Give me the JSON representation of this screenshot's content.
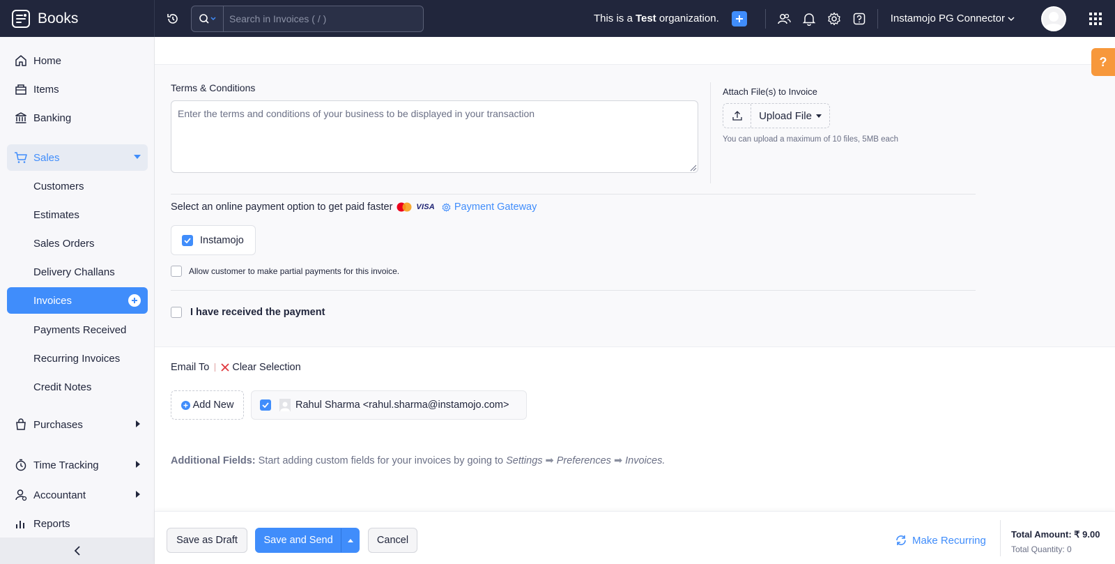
{
  "app": {
    "name": "Books"
  },
  "search": {
    "placeholder": "Search in Invoices ( / )"
  },
  "header": {
    "org_prefix": "This is a ",
    "org_bold": "Test",
    "org_suffix": " organization.",
    "org_name": "Instamojo PG Connector"
  },
  "sidebar": {
    "items": [
      {
        "label": "Home",
        "icon": "home-icon"
      },
      {
        "label": "Items",
        "icon": "items-icon"
      },
      {
        "label": "Banking",
        "icon": "bank-icon"
      },
      {
        "label": "Sales",
        "icon": "cart-icon"
      },
      {
        "label": "Purchases",
        "icon": "bag-icon"
      },
      {
        "label": "Time Tracking",
        "icon": "clock-icon"
      },
      {
        "label": "Accountant",
        "icon": "accountant-icon"
      },
      {
        "label": "Reports",
        "icon": "reports-icon"
      }
    ],
    "sales_sub": [
      "Customers",
      "Estimates",
      "Sales Orders",
      "Delivery Challans",
      "Invoices",
      "Payments Received",
      "Recurring Invoices",
      "Credit Notes"
    ]
  },
  "form": {
    "terms_label": "Terms & Conditions",
    "terms_placeholder": "Enter the terms and conditions of your business to be displayed in your transaction",
    "attach_label": "Attach File(s) to Invoice",
    "upload_label": "Upload File",
    "upload_hint": "You can upload a maximum of 10 files, 5MB each",
    "payment_text": "Select an online payment option to get paid faster",
    "visa": "VISA",
    "payment_gateway": "Payment Gateway",
    "instamojo": "Instamojo",
    "partial": "Allow customer to make partial payments for this invoice.",
    "received": "I have received the payment",
    "email_to": "Email To",
    "clear_selection": "Clear Selection",
    "add_new": "Add New",
    "contact": "Rahul Sharma <rahul.sharma@instamojo.com>",
    "additional_bold": "Additional Fields:",
    "additional_text": " Start adding custom fields for your invoices by going to ",
    "additional_settings": "Settings",
    "additional_prefs": "Preferences",
    "additional_invoices": "Invoices."
  },
  "footer": {
    "save_draft": "Save as Draft",
    "save_send": "Save and Send",
    "cancel": "Cancel",
    "make_recurring": "Make Recurring",
    "total_amount": "Total Amount: ₹ 9.00",
    "total_quantity": "Total Quantity: 0"
  },
  "help": {
    "label": "?"
  },
  "colors": {
    "accent": "#408dfb",
    "topbar": "#21263c",
    "help": "#f7983b"
  }
}
